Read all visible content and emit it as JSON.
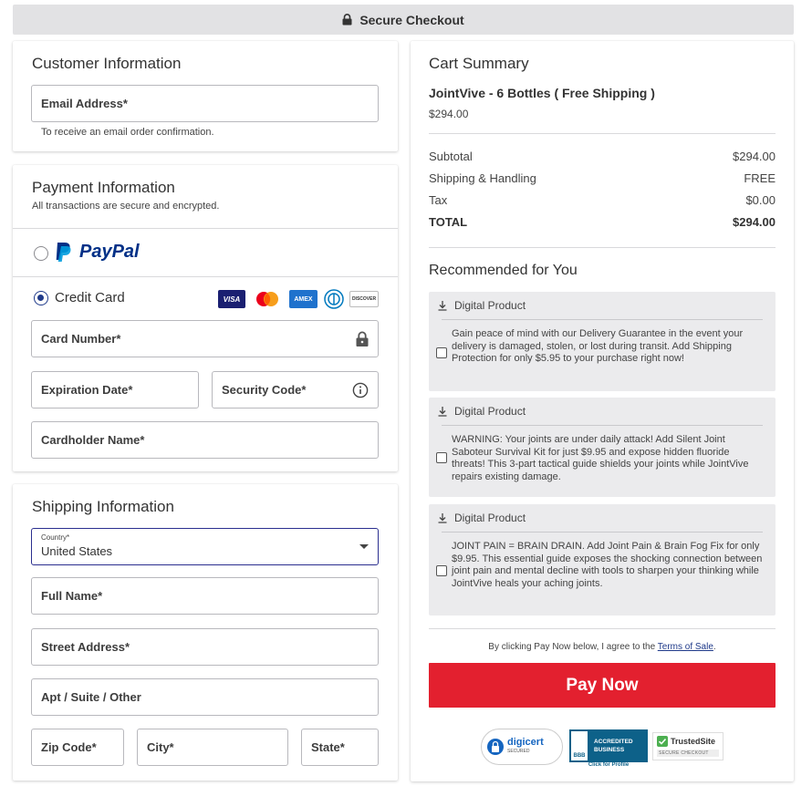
{
  "header": {
    "title": "Secure Checkout"
  },
  "customer": {
    "title": "Customer Information",
    "email_label": "Email Address*",
    "email_hint": "To receive an email order confirmation."
  },
  "payment": {
    "title": "Payment Information",
    "subtitle": "All transactions are secure and encrypted.",
    "paypal_label": "PayPal",
    "credit_card_label": "Credit Card",
    "selected_method": "Credit Card",
    "card_brands": [
      "VISA",
      "Mastercard",
      "AMEX",
      "Diners Club",
      "DISCOVER"
    ],
    "card_number_label": "Card Number*",
    "expiration_label": "Expiration Date*",
    "security_code_label": "Security Code*",
    "cardholder_label": "Cardholder Name*"
  },
  "shipping": {
    "title": "Shipping Information",
    "country_label": "Country*",
    "country_value": "United States",
    "full_name_label": "Full Name*",
    "street_label": "Street Address*",
    "apt_label": "Apt / Suite / Other",
    "zip_label": "Zip Code*",
    "city_label": "City*",
    "state_label": "State*"
  },
  "cart": {
    "title": "Cart Summary",
    "product_name": "JointVive - 6 Bottles ( Free Shipping )",
    "product_price": "$294.00",
    "rows": [
      {
        "label": "Subtotal",
        "value": "$294.00"
      },
      {
        "label": "Shipping & Handling",
        "value": "FREE"
      },
      {
        "label": "Tax",
        "value": "$0.00"
      },
      {
        "label": "TOTAL",
        "value": "$294.00"
      }
    ]
  },
  "recommended": {
    "title": "Recommended for You",
    "items": [
      {
        "header": "Digital Product",
        "text": "Gain peace of mind with our Delivery Guarantee in the event your delivery is damaged, stolen, or lost during transit. Add Shipping Protection for only $5.95 to your purchase right now!"
      },
      {
        "header": "Digital Product",
        "text": "WARNING: Your joints are under daily attack! Add Silent Joint Saboteur Survival Kit for just $9.95 and expose hidden fluoride threats! This 3-part tactical guide shields your joints while JointVive repairs existing damage."
      },
      {
        "header": "Digital Product",
        "text": "JOINT PAIN = BRAIN DRAIN. Add Joint Pain & Brain Fog Fix for only $9.95. This essential guide exposes the shocking connection between joint pain and mental decline with tools to sharpen your thinking while JointVive heals your aching joints."
      }
    ]
  },
  "terms": {
    "prefix": "By clicking Pay Now below, I agree to the ",
    "link": "Terms of Sale",
    "suffix": "."
  },
  "pay_button": "Pay Now",
  "badges": {
    "digicert": {
      "name": "digicert",
      "sub": "SECURED"
    },
    "bbb": {
      "line1": "ACCREDITED",
      "line2": "BUSINESS",
      "mark": "BBB",
      "caption": "Click for Profile"
    },
    "trustedsite": {
      "name": "TrustedSite",
      "sub": "SECURE CHECKOUT"
    }
  },
  "colors": {
    "pay_button": "#e3202f",
    "accent_blue": "#1f3a8a",
    "paypal_dark": "#003087",
    "paypal_light": "#009cde"
  }
}
